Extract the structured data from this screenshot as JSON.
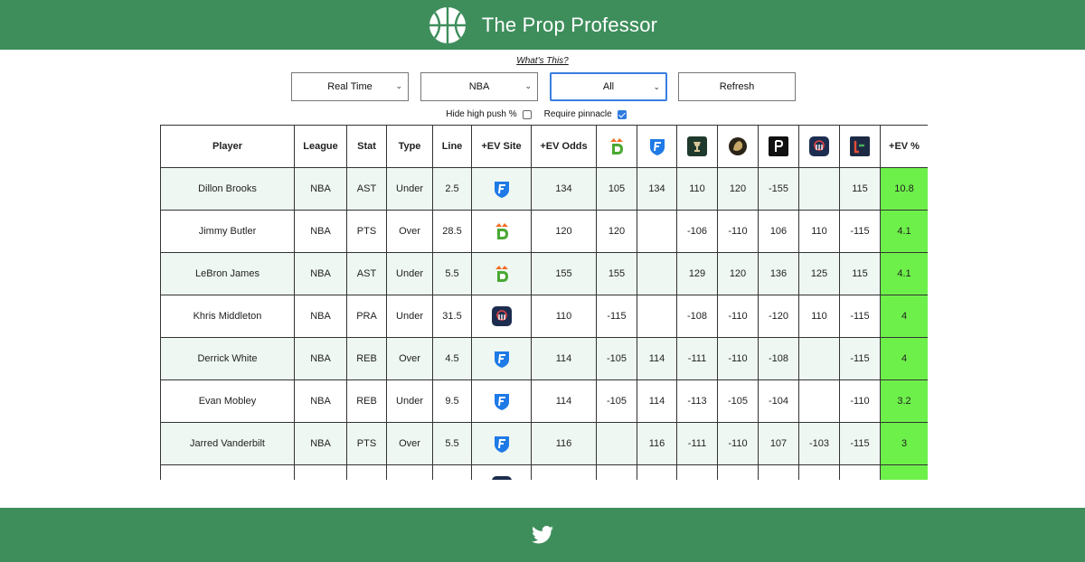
{
  "header": {
    "title": "The Prop Professor"
  },
  "whats_this": "What's This?",
  "controls": {
    "mode": "Real Time",
    "league": "NBA",
    "book": "All",
    "refresh": "Refresh"
  },
  "options": {
    "hide_high_push": {
      "label": "Hide high push %",
      "checked": false
    },
    "require_pinnacle": {
      "label": "Require pinnacle",
      "checked": true
    }
  },
  "table": {
    "headers": [
      "Player",
      "League",
      "Stat",
      "Type",
      "Line",
      "+EV Site",
      "+EV Odds"
    ],
    "book_icons": [
      "draftkings-icon",
      "fanduel-icon",
      "caesars-icon",
      "betmgm-icon",
      "pointsbet-icon",
      "barstool-icon",
      "bet365-icon"
    ],
    "ev_header": "+EV %",
    "rows": [
      {
        "player": "Dillon Brooks",
        "league": "NBA",
        "stat": "AST",
        "type": "Under",
        "line": "2.5",
        "site": "fanduel",
        "odds": "134",
        "books": [
          "105",
          "134",
          "110",
          "120",
          "-155",
          "",
          "115"
        ],
        "ev": "10.8"
      },
      {
        "player": "Jimmy Butler",
        "league": "NBA",
        "stat": "PTS",
        "type": "Over",
        "line": "28.5",
        "site": "draftkings",
        "odds": "120",
        "books": [
          "120",
          "",
          "-106",
          "-110",
          "106",
          "110",
          "-115"
        ],
        "ev": "4.1"
      },
      {
        "player": "LeBron James",
        "league": "NBA",
        "stat": "AST",
        "type": "Under",
        "line": "5.5",
        "site": "draftkings",
        "odds": "155",
        "books": [
          "155",
          "",
          "129",
          "120",
          "136",
          "125",
          "115"
        ],
        "ev": "4.1"
      },
      {
        "player": "Khris Middleton",
        "league": "NBA",
        "stat": "PRA",
        "type": "Under",
        "line": "31.5",
        "site": "barstool",
        "odds": "110",
        "books": [
          "-115",
          "",
          "-108",
          "-110",
          "-120",
          "110",
          "-115"
        ],
        "ev": "4"
      },
      {
        "player": "Derrick White",
        "league": "NBA",
        "stat": "REB",
        "type": "Over",
        "line": "4.5",
        "site": "fanduel",
        "odds": "114",
        "books": [
          "-105",
          "114",
          "-111",
          "-110",
          "-108",
          "",
          "-115"
        ],
        "ev": "4"
      },
      {
        "player": "Evan Mobley",
        "league": "NBA",
        "stat": "REB",
        "type": "Under",
        "line": "9.5",
        "site": "fanduel",
        "odds": "114",
        "books": [
          "-105",
          "114",
          "-113",
          "-105",
          "-104",
          "",
          "-110"
        ],
        "ev": "3.2"
      },
      {
        "player": "Jarred Vanderbilt",
        "league": "NBA",
        "stat": "PTS",
        "type": "Over",
        "line": "5.5",
        "site": "fanduel",
        "odds": "116",
        "books": [
          "",
          "116",
          "-111",
          "-110",
          "107",
          "-103",
          "-115"
        ],
        "ev": "3"
      },
      {
        "player": "",
        "league": "",
        "stat": "",
        "type": "",
        "line": "",
        "site": "barstool",
        "odds": "",
        "books": [
          "",
          "",
          "",
          "",
          "",
          "",
          ""
        ],
        "ev": ""
      }
    ]
  },
  "colors": {
    "brand": "#3e8e5c",
    "ev_highlight": "#6ef04a",
    "row_alt": "#eef7f1"
  }
}
